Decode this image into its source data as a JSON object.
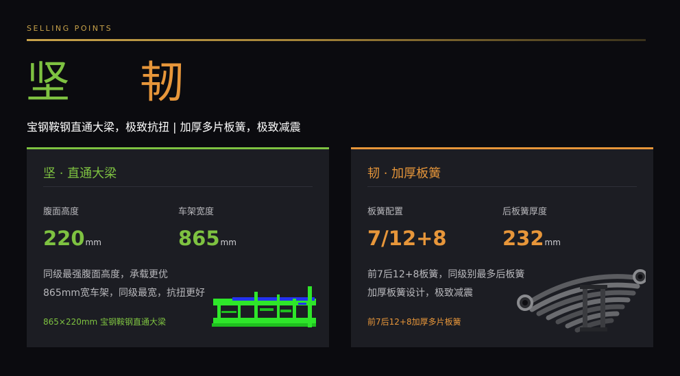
{
  "header": {
    "eyebrow": "SELLING POINTS",
    "headline_char1": "坚",
    "headline_char2": "韧",
    "subtitle": "宝钢鞍钢直通大梁，极致抗扭 | 加厚多片板簧，极致减震"
  },
  "cards": {
    "left": {
      "title": "坚 · 直通大梁",
      "stat1": {
        "label": "腹面高度",
        "value": "220",
        "unit": "mm"
      },
      "stat2": {
        "label": "车架宽度",
        "value": "865",
        "unit": "mm"
      },
      "desc1": "同级最强腹面高度，承载更优",
      "desc2": "865mm宽车架，同级最宽，抗扭更好",
      "note": "865×220mm 宝钢鞍钢直通大梁",
      "image": "chassis-frame-render"
    },
    "right": {
      "title": "韧 · 加厚板簧",
      "stat1": {
        "label": "板簧配置",
        "value": "7/12+8",
        "unit": ""
      },
      "stat2": {
        "label": "后板簧厚度",
        "value": "232",
        "unit": "mm"
      },
      "desc1": "前7后12+8板簧，同级别最多后板簧",
      "desc2": "加厚板簧设计，极致减震",
      "note": "前7后12+8加厚多片板簧",
      "image": "leaf-spring-photo"
    }
  },
  "colors": {
    "green": "#7ec241",
    "orange": "#e7963a",
    "gold": "#c9a34a",
    "background": "#0b0b0f",
    "card": "#1c1d23"
  }
}
